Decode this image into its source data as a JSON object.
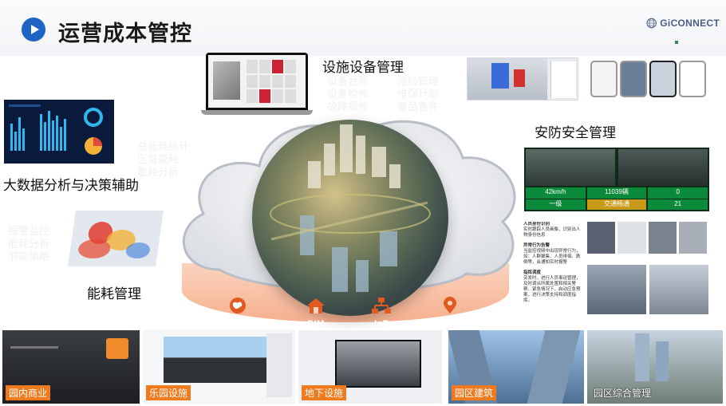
{
  "header": {
    "title": "运营成本管控",
    "brand": "GiCONNECT",
    "play_icon": "play-circle-icon",
    "brand_icon": "globe-logo-icon"
  },
  "sections": {
    "facility": {
      "label": "设施设备管理",
      "items": [
        "设备台账",
        "设备检修",
        "故障报修",
        "巡检管理",
        "维保计划",
        "备品备件"
      ]
    },
    "security": {
      "label": "安防安全管理"
    },
    "bigdata": {
      "label": "大数据分析与决策辅助",
      "items": [
        "总能耗统计",
        "区域能耗",
        "能耗分析"
      ]
    },
    "energy": {
      "label": "能耗管理",
      "items": [
        "报警监控",
        "能耗分析",
        "节能策略"
      ]
    }
  },
  "platform": {
    "items": [
      {
        "label": "GIS",
        "icon": "globe-map-icon"
      },
      {
        "label": "BIM",
        "icon": "building-house-icon"
      },
      {
        "label": "IoT",
        "icon": "network-nodes-icon"
      },
      {
        "label": "LBS",
        "icon": "location-pin-icon"
      }
    ]
  },
  "traffic_panel": {
    "row1": [
      "42km/h",
      "11039辆",
      "0"
    ],
    "row2": [
      "一级",
      "交通畅通",
      "21"
    ]
  },
  "security_notes": [
    {
      "title": "人员身份识别",
      "body": "实时跟踪人员画像，识别出人物身份信息"
    },
    {
      "title": "异常行为告警",
      "body": "当监控视频中出现异常行为，如：人群聚集、人员徘徊、跌倒等，会通知实时报警"
    },
    {
      "title": "指挥调度",
      "body": "突发时，进行人员事运管理，及时调派所属处置和相关警察、紧急情况下，启动应急预案，进行决策支持和调度指挥。"
    }
  ],
  "bottom_strip": [
    {
      "label": "园内商业"
    },
    {
      "label": "乐园设施"
    },
    {
      "label": "地下设施"
    },
    {
      "label": "园区建筑"
    },
    {
      "label": "园区综合管理"
    }
  ],
  "colors": {
    "accent_blue": "#1f64c4",
    "label_orange": "#f07b1f",
    "platform_pink": "#f6b08e",
    "dashboard_navy": "#0a1a3c"
  }
}
